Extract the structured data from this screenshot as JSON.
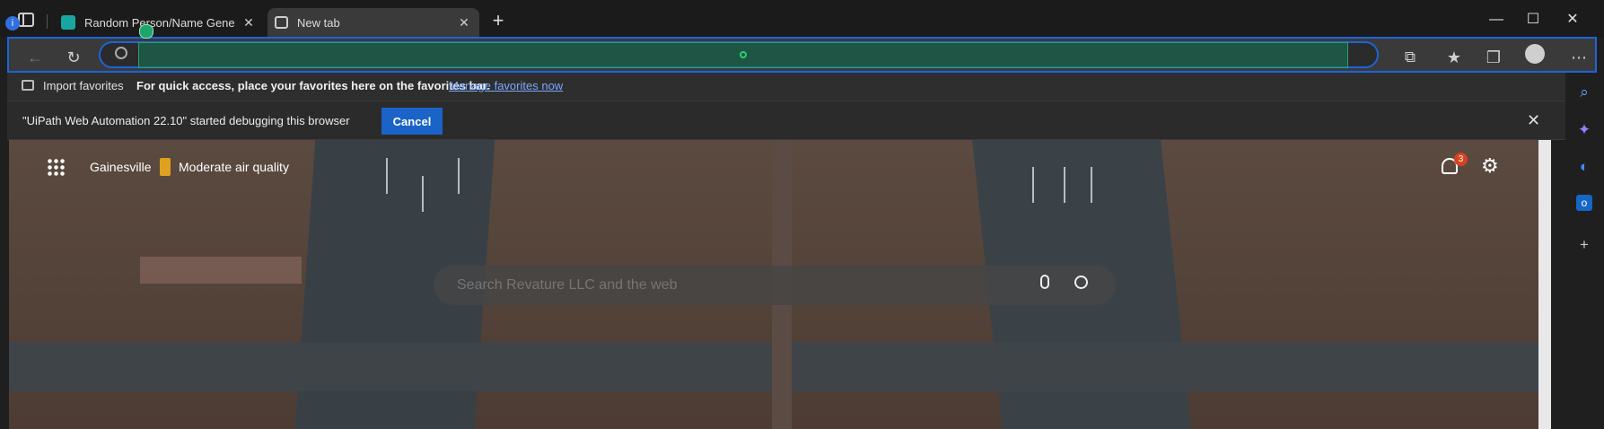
{
  "window": {
    "tabs": [
      {
        "label": "Random Person/Name Generator",
        "active": false
      },
      {
        "label": "New tab",
        "active": true
      }
    ],
    "new_tab": "+",
    "controls": {
      "minimize": "—",
      "maximize": "☐",
      "close": "✕"
    }
  },
  "toolbar": {
    "address_value": "",
    "address_placeholder": ""
  },
  "favorites_bar": {
    "import_label": "Import favorites",
    "hint": "For quick access, place your favorites here on the favorites bar.",
    "manage_link": "Manage favorites now"
  },
  "debug_bar": {
    "message": "\"UiPath Web Automation 22.10\" started debugging this browser",
    "cancel_label": "Cancel"
  },
  "newtab": {
    "location": "Gainesville",
    "air_quality": "Moderate air quality",
    "notifications_count": "3",
    "search_placeholder": "Search Revature LLC and the web"
  },
  "icons": {
    "apps": "apps-grid-icon",
    "mic": "mic-icon",
    "search": "search-icon",
    "bell": "bell-icon",
    "settings": "gear-icon"
  },
  "colors": {
    "accent": "#1c64d9",
    "cancel_button": "#1a64c8",
    "badge": "#d8421f",
    "link": "#7aa7ff"
  }
}
